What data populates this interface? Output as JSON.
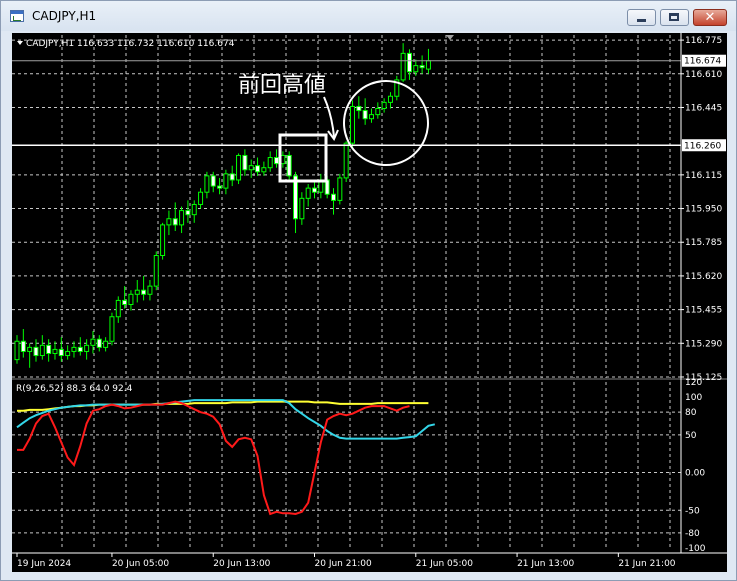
{
  "window": {
    "title": "CADJPY,H1",
    "minimize_glyph": "",
    "maximize_glyph": "",
    "close_glyph": "✕"
  },
  "chart_data": [
    {
      "type": "candlestick",
      "header": "CADJPY,H1  116.633 116.732 116.610 116.674",
      "annotation": "前回高値",
      "y_ticks": [
        "116.775",
        "116.610",
        "116.445",
        "116.115",
        "115.950",
        "115.785",
        "115.620",
        "115.455",
        "115.290",
        "115.125"
      ],
      "y_tick_values": [
        116.775,
        116.61,
        116.445,
        116.115,
        115.95,
        115.785,
        115.62,
        115.455,
        115.29,
        115.125
      ],
      "ylim": [
        115.12,
        116.8
      ],
      "bid_price": 116.674,
      "bid_label": "116.674",
      "level_price": 116.26,
      "level_label": "116.260",
      "grid": true,
      "x_ticks": [
        "19 Jun 2024",
        "20 Jun 05:00",
        "20 Jun 13:00",
        "20 Jun 21:00",
        "21 Jun 05:00",
        "21 Jun 13:00",
        "21 Jun 21:00"
      ],
      "x_tick_index": [
        0,
        15,
        31,
        47,
        63,
        79,
        95
      ],
      "candles": [
        {
          "o": 115.21,
          "h": 115.33,
          "l": 115.19,
          "c": 115.3
        },
        {
          "o": 115.3,
          "h": 115.36,
          "l": 115.22,
          "c": 115.25
        },
        {
          "o": 115.25,
          "h": 115.29,
          "l": 115.17,
          "c": 115.27
        },
        {
          "o": 115.27,
          "h": 115.31,
          "l": 115.2,
          "c": 115.23
        },
        {
          "o": 115.23,
          "h": 115.33,
          "l": 115.21,
          "c": 115.28
        },
        {
          "o": 115.28,
          "h": 115.31,
          "l": 115.2,
          "c": 115.24
        },
        {
          "o": 115.24,
          "h": 115.3,
          "l": 115.21,
          "c": 115.26
        },
        {
          "o": 115.26,
          "h": 115.32,
          "l": 115.2,
          "c": 115.23
        },
        {
          "o": 115.23,
          "h": 115.28,
          "l": 115.21,
          "c": 115.25
        },
        {
          "o": 115.25,
          "h": 115.3,
          "l": 115.22,
          "c": 115.27
        },
        {
          "o": 115.27,
          "h": 115.32,
          "l": 115.23,
          "c": 115.25
        },
        {
          "o": 115.25,
          "h": 115.31,
          "l": 115.21,
          "c": 115.28
        },
        {
          "o": 115.28,
          "h": 115.35,
          "l": 115.24,
          "c": 115.31
        },
        {
          "o": 115.31,
          "h": 115.33,
          "l": 115.25,
          "c": 115.27
        },
        {
          "o": 115.27,
          "h": 115.32,
          "l": 115.25,
          "c": 115.3
        },
        {
          "o": 115.3,
          "h": 115.44,
          "l": 115.28,
          "c": 115.42
        },
        {
          "o": 115.42,
          "h": 115.52,
          "l": 115.39,
          "c": 115.5
        },
        {
          "o": 115.5,
          "h": 115.57,
          "l": 115.46,
          "c": 115.48
        },
        {
          "o": 115.48,
          "h": 115.55,
          "l": 115.45,
          "c": 115.53
        },
        {
          "o": 115.53,
          "h": 115.6,
          "l": 115.49,
          "c": 115.55
        },
        {
          "o": 115.55,
          "h": 115.62,
          "l": 115.5,
          "c": 115.53
        },
        {
          "o": 115.53,
          "h": 115.6,
          "l": 115.5,
          "c": 115.57
        },
        {
          "o": 115.57,
          "h": 115.74,
          "l": 115.55,
          "c": 115.72
        },
        {
          "o": 115.72,
          "h": 115.88,
          "l": 115.7,
          "c": 115.87
        },
        {
          "o": 115.87,
          "h": 115.94,
          "l": 115.82,
          "c": 115.9
        },
        {
          "o": 115.9,
          "h": 115.98,
          "l": 115.84,
          "c": 115.87
        },
        {
          "o": 115.87,
          "h": 115.96,
          "l": 115.83,
          "c": 115.94
        },
        {
          "o": 115.94,
          "h": 115.99,
          "l": 115.88,
          "c": 115.92
        },
        {
          "o": 115.92,
          "h": 115.99,
          "l": 115.88,
          "c": 115.97
        },
        {
          "o": 115.97,
          "h": 116.05,
          "l": 115.95,
          "c": 116.03
        },
        {
          "o": 116.03,
          "h": 116.13,
          "l": 116.0,
          "c": 116.11
        },
        {
          "o": 116.11,
          "h": 116.13,
          "l": 116.03,
          "c": 116.06
        },
        {
          "o": 116.06,
          "h": 116.1,
          "l": 116.02,
          "c": 116.05
        },
        {
          "o": 116.05,
          "h": 116.14,
          "l": 116.02,
          "c": 116.12
        },
        {
          "o": 116.12,
          "h": 116.16,
          "l": 116.06,
          "c": 116.09
        },
        {
          "o": 116.09,
          "h": 116.22,
          "l": 116.07,
          "c": 116.21
        },
        {
          "o": 116.21,
          "h": 116.24,
          "l": 116.11,
          "c": 116.14
        },
        {
          "o": 116.14,
          "h": 116.19,
          "l": 116.1,
          "c": 116.16
        },
        {
          "o": 116.16,
          "h": 116.2,
          "l": 116.11,
          "c": 116.13
        },
        {
          "o": 116.13,
          "h": 116.18,
          "l": 116.11,
          "c": 116.15
        },
        {
          "o": 116.15,
          "h": 116.23,
          "l": 116.13,
          "c": 116.2
        },
        {
          "o": 116.2,
          "h": 116.24,
          "l": 116.15,
          "c": 116.17
        },
        {
          "o": 116.17,
          "h": 116.23,
          "l": 116.15,
          "c": 116.21
        },
        {
          "o": 116.21,
          "h": 116.23,
          "l": 116.09,
          "c": 116.11
        },
        {
          "o": 116.11,
          "h": 116.13,
          "l": 115.83,
          "c": 115.9
        },
        {
          "o": 115.9,
          "h": 116.03,
          "l": 115.87,
          "c": 116.0
        },
        {
          "o": 116.0,
          "h": 116.07,
          "l": 115.96,
          "c": 116.05
        },
        {
          "o": 116.05,
          "h": 116.09,
          "l": 116.0,
          "c": 116.03
        },
        {
          "o": 116.03,
          "h": 116.12,
          "l": 116.0,
          "c": 116.09
        },
        {
          "o": 116.09,
          "h": 116.11,
          "l": 116.0,
          "c": 116.02
        },
        {
          "o": 116.02,
          "h": 116.05,
          "l": 115.92,
          "c": 115.99
        },
        {
          "o": 115.99,
          "h": 116.12,
          "l": 115.97,
          "c": 116.1
        },
        {
          "o": 116.1,
          "h": 116.28,
          "l": 116.08,
          "c": 116.27
        },
        {
          "o": 116.27,
          "h": 116.48,
          "l": 116.25,
          "c": 116.45
        },
        {
          "o": 116.45,
          "h": 116.5,
          "l": 116.39,
          "c": 116.43
        },
        {
          "o": 116.43,
          "h": 116.49,
          "l": 116.36,
          "c": 116.39
        },
        {
          "o": 116.39,
          "h": 116.44,
          "l": 116.37,
          "c": 116.41
        },
        {
          "o": 116.41,
          "h": 116.47,
          "l": 116.39,
          "c": 116.44
        },
        {
          "o": 116.44,
          "h": 116.49,
          "l": 116.42,
          "c": 116.47
        },
        {
          "o": 116.47,
          "h": 116.52,
          "l": 116.44,
          "c": 116.5
        },
        {
          "o": 116.5,
          "h": 116.6,
          "l": 116.48,
          "c": 116.58
        },
        {
          "o": 116.58,
          "h": 116.76,
          "l": 116.57,
          "c": 116.71
        },
        {
          "o": 116.71,
          "h": 116.73,
          "l": 116.58,
          "c": 116.62
        },
        {
          "o": 116.62,
          "h": 116.68,
          "l": 116.6,
          "c": 116.65
        },
        {
          "o": 116.65,
          "h": 116.7,
          "l": 116.61,
          "c": 116.64
        },
        {
          "o": 116.633,
          "h": 116.732,
          "l": 116.61,
          "c": 116.674
        }
      ],
      "indicator": {
        "label": "R(9,26,52) 88.3 64.0 92.4",
        "ylim": [
          -100,
          120
        ],
        "y_ticks": [
          "120",
          "100",
          "80",
          "50",
          "0.00",
          "-50",
          "-80",
          "-100"
        ],
        "y_tick_values": [
          120,
          100,
          80,
          50,
          0,
          -50,
          -80,
          -100
        ],
        "grid_levels": [
          80,
          50,
          0,
          -50,
          -80
        ],
        "series": [
          {
            "color": "#ffff33",
            "values": [
              82,
              82,
              83,
              83,
              83,
              84,
              85,
              86,
              87,
              88,
              88,
              89,
              89,
              90,
              90,
              90,
              90,
              90,
              90,
              90,
              90,
              90,
              91,
              91,
              91,
              91,
              91,
              91,
              92,
              92,
              92,
              92,
              92,
              92,
              93,
              93,
              93,
              93,
              94,
              94,
              94,
              94,
              94,
              94,
              94,
              94,
              94,
              93,
              93,
              93,
              92,
              91,
              91,
              91,
              91,
              91,
              91,
              92,
              92,
              92,
              92,
              92,
              92,
              92,
              92,
              92
            ]
          },
          {
            "color": "#33d6e8",
            "values": [
              60,
              66,
              72,
              76,
              79,
              82,
              84,
              86,
              87,
              88,
              89,
              89,
              90,
              90,
              90,
              90,
              90,
              90,
              90,
              90,
              90,
              90,
              90,
              91,
              92,
              93,
              94,
              95,
              96,
              96,
              96,
              96,
              96,
              96,
              96,
              96,
              96,
              96,
              96,
              96,
              96,
              96,
              96,
              92,
              84,
              78,
              72,
              67,
              62,
              55,
              50,
              46,
              45,
              45,
              45,
              45,
              45,
              45,
              45,
              45,
              45,
              46,
              47,
              48,
              55,
              62,
              64
            ]
          },
          {
            "color": "#ff1a1a",
            "values": [
              30,
              30,
              45,
              65,
              75,
              78,
              60,
              40,
              20,
              10,
              35,
              65,
              82,
              84,
              88,
              90,
              88,
              85,
              86,
              88,
              90,
              90,
              90,
              90,
              92,
              94,
              92,
              88,
              84,
              80,
              78,
              74,
              64,
              42,
              34,
              44,
              46,
              44,
              22,
              -30,
              -55,
              -52,
              -54,
              -54,
              -55,
              -52,
              -40,
              0,
              40,
              70,
              75,
              78,
              76,
              78,
              82,
              86,
              88,
              88,
              88,
              85,
              82,
              86,
              88
            ]
          }
        ]
      }
    }
  ]
}
